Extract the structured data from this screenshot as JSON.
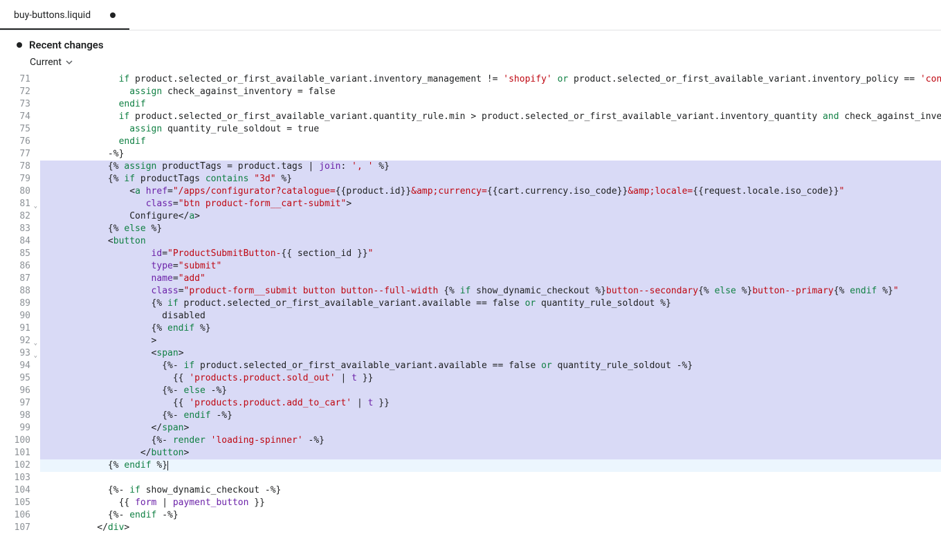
{
  "tab": {
    "name": "buy-buttons.liquid",
    "modified": true
  },
  "header": {
    "title": "Recent changes",
    "branch": "Current"
  },
  "editor": {
    "first_line": 71,
    "selected_range": [
      78,
      101
    ],
    "cursor_line": 102,
    "fold_markers": [
      81,
      92,
      93
    ],
    "lines": [
      {
        "n": 71,
        "segs": [
          [
            "pl",
            "              "
          ],
          [
            "kw",
            "if"
          ],
          [
            "pl",
            " product.selected_or_first_available_variant.inventory_management != "
          ],
          [
            "str",
            "'shopify'"
          ],
          [
            "pl",
            " "
          ],
          [
            "kw",
            "or"
          ],
          [
            "pl",
            " product.selected_or_first_available_variant.inventory_policy == "
          ],
          [
            "str",
            "'continue'"
          ]
        ]
      },
      {
        "n": 72,
        "segs": [
          [
            "pl",
            "                "
          ],
          [
            "kw",
            "assign"
          ],
          [
            "pl",
            " check_against_inventory = false"
          ]
        ]
      },
      {
        "n": 73,
        "segs": [
          [
            "pl",
            "              "
          ],
          [
            "kw",
            "endif"
          ]
        ]
      },
      {
        "n": 74,
        "segs": [
          [
            "pl",
            "              "
          ],
          [
            "kw",
            "if"
          ],
          [
            "pl",
            " product.selected_or_first_available_variant.quantity_rule.min > product.selected_or_first_available_variant.inventory_quantity "
          ],
          [
            "kw",
            "and"
          ],
          [
            "pl",
            " check_against_inventory"
          ]
        ]
      },
      {
        "n": 75,
        "segs": [
          [
            "pl",
            "                "
          ],
          [
            "kw",
            "assign"
          ],
          [
            "pl",
            " quantity_rule_soldout = true"
          ]
        ]
      },
      {
        "n": 76,
        "segs": [
          [
            "pl",
            "              "
          ],
          [
            "kw",
            "endif"
          ]
        ]
      },
      {
        "n": 77,
        "segs": [
          [
            "pl",
            "            -%}"
          ]
        ]
      },
      {
        "n": 78,
        "segs": [
          [
            "pl",
            "            {% "
          ],
          [
            "kw",
            "assign"
          ],
          [
            "pl",
            " productTags = product.tags | "
          ],
          [
            "filter",
            "join"
          ],
          [
            "pl",
            ": "
          ],
          [
            "str",
            "', '"
          ],
          [
            "pl",
            " %}"
          ]
        ]
      },
      {
        "n": 79,
        "segs": [
          [
            "pl",
            "            {% "
          ],
          [
            "kw",
            "if"
          ],
          [
            "pl",
            " productTags "
          ],
          [
            "kw",
            "contains"
          ],
          [
            "pl",
            " "
          ],
          [
            "str",
            "\"3d\""
          ],
          [
            "pl",
            " %}"
          ]
        ]
      },
      {
        "n": 80,
        "segs": [
          [
            "pl",
            "                <"
          ],
          [
            "tag",
            "a"
          ],
          [
            "pl",
            " "
          ],
          [
            "attr",
            "href"
          ],
          [
            "pl",
            "="
          ],
          [
            "str",
            "\"/apps/configurator?catalogue="
          ],
          [
            "pl",
            "{{product.id}}"
          ],
          [
            "str",
            "&amp;currency="
          ],
          [
            "pl",
            "{{cart.currency.iso_code}}"
          ],
          [
            "str",
            "&amp;locale="
          ],
          [
            "pl",
            "{{request.locale.iso_code}}"
          ],
          [
            "str",
            "\""
          ]
        ]
      },
      {
        "n": 81,
        "segs": [
          [
            "pl",
            "                   "
          ],
          [
            "attr",
            "class"
          ],
          [
            "pl",
            "="
          ],
          [
            "str",
            "\"btn product-form__cart-submit\""
          ],
          [
            "pl",
            ">"
          ]
        ]
      },
      {
        "n": 82,
        "segs": [
          [
            "pl",
            "                Configure</"
          ],
          [
            "tag",
            "a"
          ],
          [
            "pl",
            ">"
          ]
        ]
      },
      {
        "n": 83,
        "segs": [
          [
            "pl",
            "            {% "
          ],
          [
            "kw",
            "else"
          ],
          [
            "pl",
            " %}"
          ]
        ]
      },
      {
        "n": 84,
        "segs": [
          [
            "pl",
            "            <"
          ],
          [
            "tag",
            "button"
          ]
        ]
      },
      {
        "n": 85,
        "segs": [
          [
            "pl",
            "                    "
          ],
          [
            "attr",
            "id"
          ],
          [
            "pl",
            "="
          ],
          [
            "str",
            "\"ProductSubmitButton-"
          ],
          [
            "pl",
            "{{ section_id }}"
          ],
          [
            "str",
            "\""
          ]
        ]
      },
      {
        "n": 86,
        "segs": [
          [
            "pl",
            "                    "
          ],
          [
            "attr",
            "type"
          ],
          [
            "pl",
            "="
          ],
          [
            "str",
            "\"submit\""
          ]
        ]
      },
      {
        "n": 87,
        "segs": [
          [
            "pl",
            "                    "
          ],
          [
            "attr",
            "name"
          ],
          [
            "pl",
            "="
          ],
          [
            "str",
            "\"add\""
          ]
        ]
      },
      {
        "n": 88,
        "segs": [
          [
            "pl",
            "                    "
          ],
          [
            "attr",
            "class"
          ],
          [
            "pl",
            "="
          ],
          [
            "str",
            "\"product-form__submit button button--full-width "
          ],
          [
            "pl",
            "{% "
          ],
          [
            "kw",
            "if"
          ],
          [
            "pl",
            " show_dynamic_checkout %}"
          ],
          [
            "str",
            "button--secondary"
          ],
          [
            "pl",
            "{% "
          ],
          [
            "kw",
            "else"
          ],
          [
            "pl",
            " %}"
          ],
          [
            "str",
            "button--primary"
          ],
          [
            "pl",
            "{% "
          ],
          [
            "kw",
            "endif"
          ],
          [
            "pl",
            " %}"
          ],
          [
            "str",
            "\""
          ]
        ]
      },
      {
        "n": 89,
        "segs": [
          [
            "pl",
            "                    {% "
          ],
          [
            "kw",
            "if"
          ],
          [
            "pl",
            " product.selected_or_first_available_variant.available == false "
          ],
          [
            "kw",
            "or"
          ],
          [
            "pl",
            " quantity_rule_soldout %}"
          ]
        ]
      },
      {
        "n": 90,
        "segs": [
          [
            "pl",
            "                      disabled"
          ]
        ]
      },
      {
        "n": 91,
        "segs": [
          [
            "pl",
            "                    {% "
          ],
          [
            "kw",
            "endif"
          ],
          [
            "pl",
            " %}"
          ]
        ]
      },
      {
        "n": 92,
        "segs": [
          [
            "pl",
            "                    >"
          ]
        ]
      },
      {
        "n": 93,
        "segs": [
          [
            "pl",
            "                    <"
          ],
          [
            "tag",
            "span"
          ],
          [
            "pl",
            ">"
          ]
        ]
      },
      {
        "n": 94,
        "segs": [
          [
            "pl",
            "                      {%- "
          ],
          [
            "kw",
            "if"
          ],
          [
            "pl",
            " product.selected_or_first_available_variant.available == false "
          ],
          [
            "kw",
            "or"
          ],
          [
            "pl",
            " quantity_rule_soldout -%}"
          ]
        ]
      },
      {
        "n": 95,
        "segs": [
          [
            "pl",
            "                        {{ "
          ],
          [
            "str",
            "'products.product.sold_out'"
          ],
          [
            "pl",
            " | "
          ],
          [
            "filter",
            "t"
          ],
          [
            "pl",
            " }}"
          ]
        ]
      },
      {
        "n": 96,
        "segs": [
          [
            "pl",
            "                      {%- "
          ],
          [
            "kw",
            "else"
          ],
          [
            "pl",
            " -%}"
          ]
        ]
      },
      {
        "n": 97,
        "segs": [
          [
            "pl",
            "                        {{ "
          ],
          [
            "str",
            "'products.product.add_to_cart'"
          ],
          [
            "pl",
            " | "
          ],
          [
            "filter",
            "t"
          ],
          [
            "pl",
            " }}"
          ]
        ]
      },
      {
        "n": 98,
        "segs": [
          [
            "pl",
            "                      {%- "
          ],
          [
            "kw",
            "endif"
          ],
          [
            "pl",
            " -%}"
          ]
        ]
      },
      {
        "n": 99,
        "segs": [
          [
            "pl",
            "                    </"
          ],
          [
            "tag",
            "span"
          ],
          [
            "pl",
            ">"
          ]
        ]
      },
      {
        "n": 100,
        "segs": [
          [
            "pl",
            "                    {%- "
          ],
          [
            "kw",
            "render"
          ],
          [
            "pl",
            " "
          ],
          [
            "str",
            "'loading-spinner'"
          ],
          [
            "pl",
            " -%}"
          ]
        ]
      },
      {
        "n": 101,
        "segs": [
          [
            "pl",
            "                  </"
          ],
          [
            "tag",
            "button"
          ],
          [
            "pl",
            ">"
          ]
        ]
      },
      {
        "n": 102,
        "segs": [
          [
            "pl",
            "            {% "
          ],
          [
            "kw",
            "endif"
          ],
          [
            "pl",
            " %}"
          ]
        ]
      },
      {
        "n": 103,
        "segs": [
          [
            "pl",
            ""
          ]
        ]
      },
      {
        "n": 104,
        "segs": [
          [
            "pl",
            "            {%- "
          ],
          [
            "kw",
            "if"
          ],
          [
            "pl",
            " show_dynamic_checkout -%}"
          ]
        ]
      },
      {
        "n": 105,
        "segs": [
          [
            "pl",
            "              {{ "
          ],
          [
            "attr",
            "form"
          ],
          [
            "pl",
            " | "
          ],
          [
            "filter",
            "payment_button"
          ],
          [
            "pl",
            " }}"
          ]
        ]
      },
      {
        "n": 106,
        "segs": [
          [
            "pl",
            "            {%- "
          ],
          [
            "kw",
            "endif"
          ],
          [
            "pl",
            " -%}"
          ]
        ]
      },
      {
        "n": 107,
        "segs": [
          [
            "pl",
            "          </"
          ],
          [
            "tag",
            "div"
          ],
          [
            "pl",
            ">"
          ]
        ]
      }
    ]
  }
}
